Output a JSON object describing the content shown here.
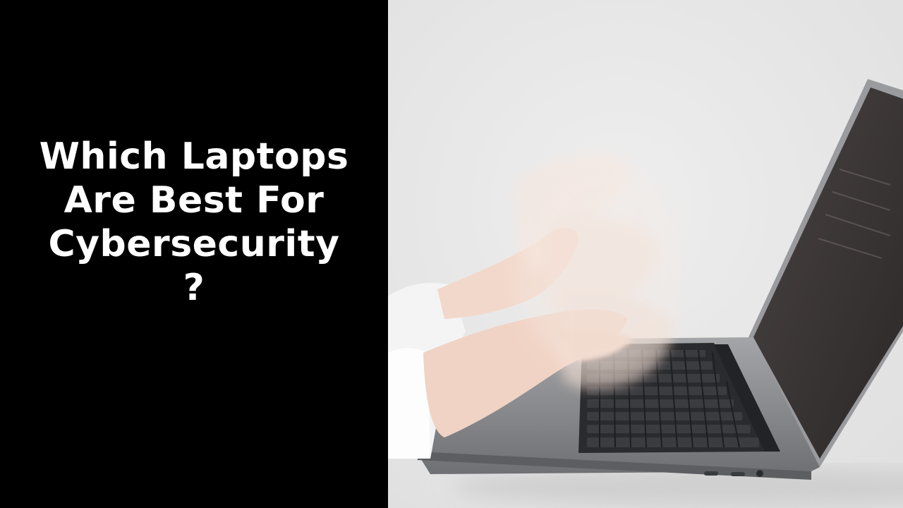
{
  "headline": {
    "lines": [
      "Which Laptops",
      "Are Best For",
      "Cybersecurity",
      "?"
    ]
  },
  "photo": {
    "subject": "laptop-typing-photo"
  },
  "colors": {
    "panel_background": "#000000",
    "headline_text": "#ffffff",
    "photo_background": "#e8e8e8",
    "laptop_body": "#8e8f92",
    "keyboard": "#2a2b2e",
    "screen": "#3a3636",
    "skin": "#f1d5c6",
    "sleeve": "#f4f4f4"
  }
}
